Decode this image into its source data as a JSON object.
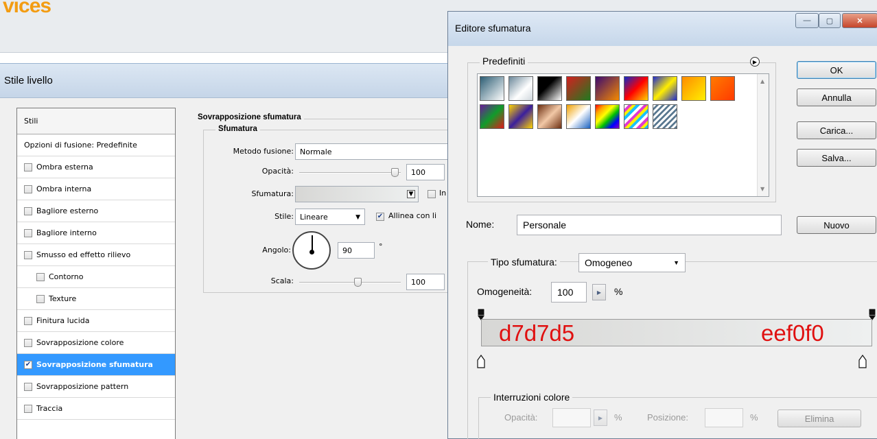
{
  "background": {
    "logo_text": "vices"
  },
  "layer_style": {
    "title": "Stile livello",
    "list": {
      "header": "Stili",
      "blend_options": "Opzioni di fusione: Predefinite",
      "items": [
        {
          "label": "Ombra esterna",
          "checked": false
        },
        {
          "label": "Ombra interna",
          "checked": false
        },
        {
          "label": "Bagliore esterno",
          "checked": false
        },
        {
          "label": "Bagliore interno",
          "checked": false
        },
        {
          "label": "Smusso ed effetto rilievo",
          "checked": false
        },
        {
          "label": "Contorno",
          "checked": false
        },
        {
          "label": "Texture",
          "checked": false
        },
        {
          "label": "Finitura lucida",
          "checked": false
        },
        {
          "label": "Sovrapposizione colore",
          "checked": false
        },
        {
          "label": "Sovrapposizione sfumatura",
          "checked": true
        },
        {
          "label": "Sovrapposizione pattern",
          "checked": false
        },
        {
          "label": "Traccia",
          "checked": false
        }
      ]
    },
    "panel": {
      "group_title": "Sovrapposizione sfumatura",
      "subgroup_title": "Sfumatura",
      "blend_mode_label": "Metodo fusione:",
      "blend_mode_value": "Normale",
      "opacity_label": "Opacità:",
      "opacity_value": "100",
      "opacity_fraction": 1.0,
      "gradient_label": "Sfumatura:",
      "reverse_label": "In",
      "style_label": "Stile:",
      "style_value": "Lineare",
      "align_label": "Allinea con li",
      "align_checked": true,
      "angle_label": "Angolo:",
      "angle_value": "90",
      "degree_symbol": "°",
      "scale_label": "Scala:",
      "scale_value": "100",
      "scale_fraction": 0.6
    }
  },
  "gradient_editor": {
    "title": "Editore sfumatura",
    "presets_label": "Predefiniti",
    "buttons": {
      "ok": "OK",
      "cancel": "Annulla",
      "load": "Carica...",
      "save": "Salva...",
      "new": "Nuovo",
      "delete": "Elimina"
    },
    "name_label": "Nome:",
    "name_value": "Personale",
    "type_label": "Tipo sfumatura:",
    "type_value": "Omogeneo",
    "smoothness_label": "Omogeneità:",
    "smoothness_value": "100",
    "percent": "%",
    "stops_group": "Interruzioni colore",
    "opacity_label": "Opacità:",
    "location_label": "Posizione:",
    "color_start": "d7d7d5",
    "color_end": "eef0f0",
    "colors": {
      "start": "#d7d7d5",
      "end": "#eef0f0",
      "annotation": "#e01010"
    }
  }
}
